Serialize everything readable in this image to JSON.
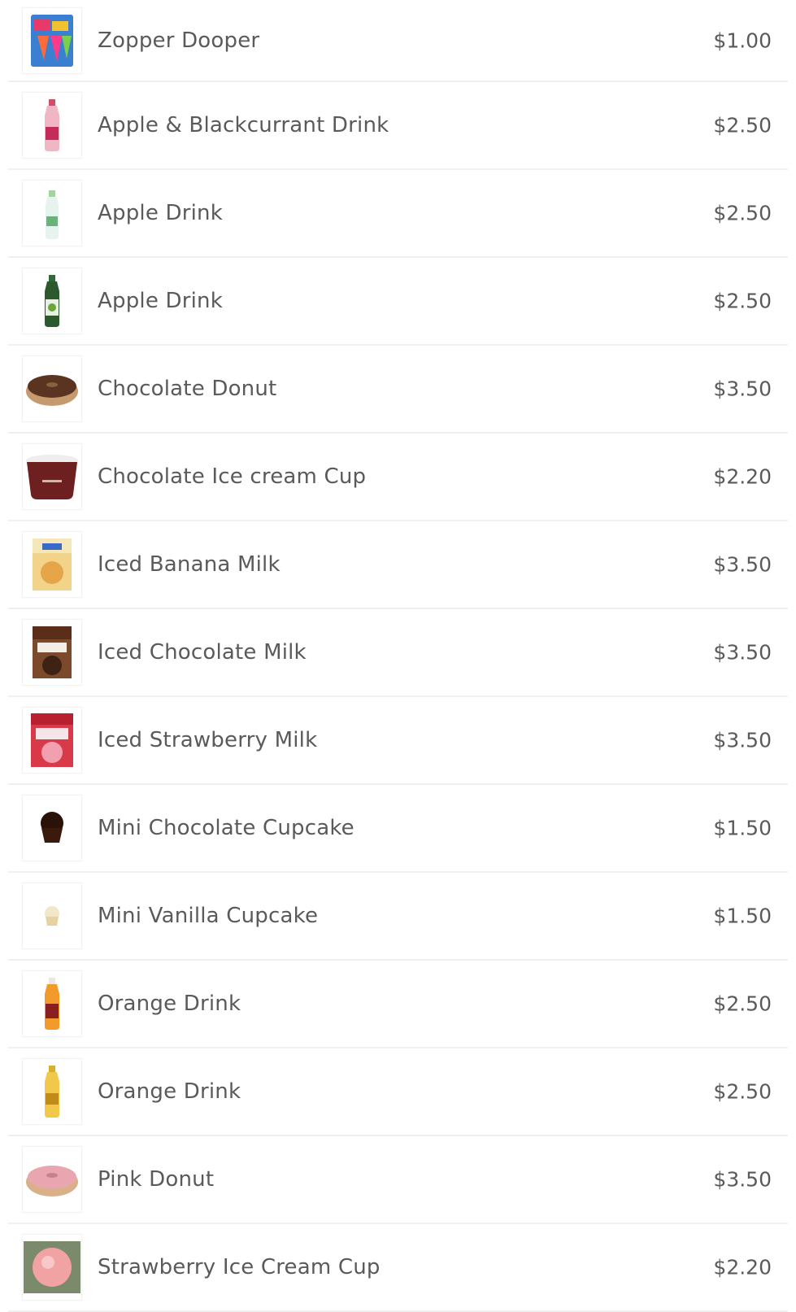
{
  "menu": {
    "items": [
      {
        "name": "Zopper Dooper",
        "price": "$1.00",
        "icon": "ice-pop-pack-icon"
      },
      {
        "name": "Apple & Blackcurrant Drink",
        "price": "$2.50",
        "icon": "pink-bottle-icon"
      },
      {
        "name": "Apple Drink",
        "price": "$2.50",
        "icon": "clear-bottle-icon"
      },
      {
        "name": "Apple Drink",
        "price": "$2.50",
        "icon": "green-bottle-icon"
      },
      {
        "name": "Chocolate Donut",
        "price": "$3.50",
        "icon": "chocolate-donut-icon"
      },
      {
        "name": "Chocolate Ice cream Cup",
        "price": "$2.20",
        "icon": "ice-cream-cup-icon"
      },
      {
        "name": "Iced Banana Milk",
        "price": "$3.50",
        "icon": "banana-milk-carton-icon"
      },
      {
        "name": "Iced Chocolate Milk",
        "price": "$3.50",
        "icon": "chocolate-milk-carton-icon"
      },
      {
        "name": "Iced Strawberry Milk",
        "price": "$3.50",
        "icon": "strawberry-milk-carton-icon"
      },
      {
        "name": "Mini Chocolate Cupcake",
        "price": "$1.50",
        "icon": "chocolate-cupcake-icon"
      },
      {
        "name": "Mini Vanilla Cupcake",
        "price": "$1.50",
        "icon": "vanilla-cupcake-icon"
      },
      {
        "name": "Orange Drink",
        "price": "$2.50",
        "icon": "orange-bottle-icon"
      },
      {
        "name": "Orange Drink",
        "price": "$2.50",
        "icon": "yellow-bottle-icon"
      },
      {
        "name": "Pink Donut",
        "price": "$3.50",
        "icon": "pink-donut-icon"
      },
      {
        "name": "Strawberry Ice Cream Cup",
        "price": "$2.20",
        "icon": "strawberry-ice-cream-cup-icon"
      }
    ]
  },
  "colors": {
    "text": "#5a5a5a",
    "divider": "#f0f0f0",
    "background": "#ffffff"
  }
}
